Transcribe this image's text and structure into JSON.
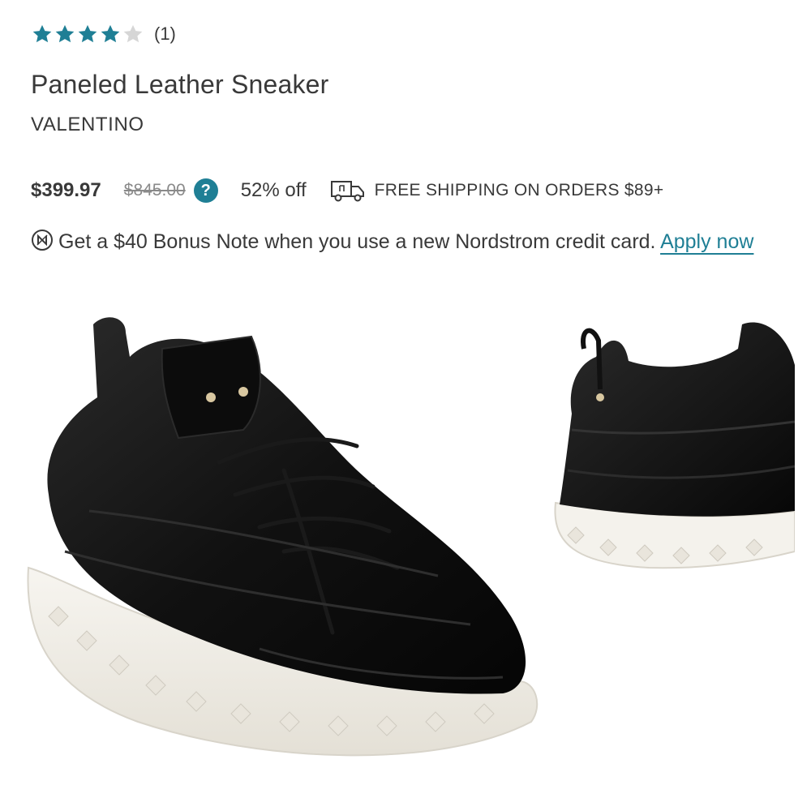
{
  "rating": {
    "stars_filled": 4,
    "stars_total": 5,
    "count_text": "(1)",
    "star_color": "#1f7f95",
    "empty_star_color": "#d6d6d6"
  },
  "product": {
    "title": "Paneled Leather Sneaker",
    "brand": "VALENTINO"
  },
  "pricing": {
    "price": "$399.97",
    "original_price": "$845.00",
    "help_label": "?",
    "discount": "52% off",
    "shipping": "FREE SHIPPING ON ORDERS $89+"
  },
  "promo": {
    "text": "Get a $40 Bonus Note when you use a new Nordstrom credit card.",
    "link_label": "Apply now",
    "link_color": "#1f7f95"
  },
  "icons": {
    "star": "star-icon",
    "help": "question-circle-icon",
    "shipping": "truck-icon",
    "note": "nordstrom-note-icon"
  },
  "images": {
    "main": "sneaker-front-three-quarter-image",
    "side": "sneaker-back-image"
  }
}
